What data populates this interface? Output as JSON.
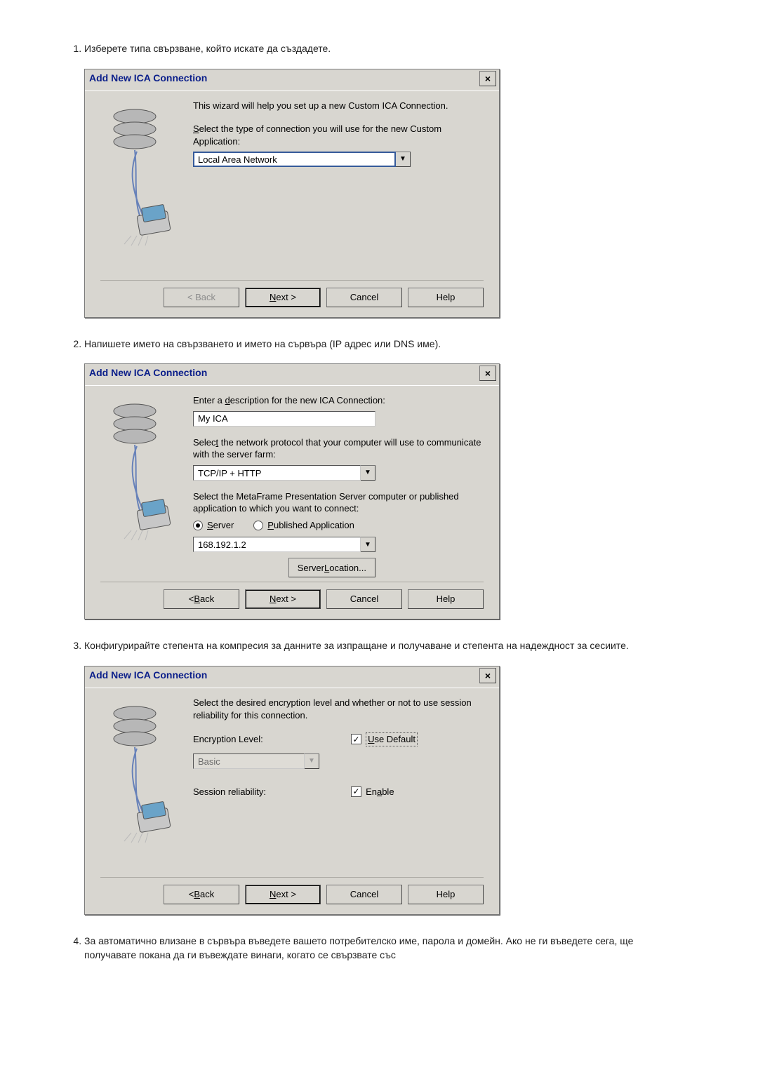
{
  "steps": {
    "s1": "Изберете типа свързване, който искате да създадете.",
    "s2": "Напишете името на свързването и името на сървъра (IP адрес или DNS име).",
    "s3": "Конфигурирайте степента на компресия за данните за изпращане и получаване и степента на надеждност за сесиите.",
    "s4": "За автоматично влизане в сървъра въведете вашето потребителско име, парола и домейн. Ако не ги въведете сега, ще получавате покана да ги въвеждате винаги, когато се свързвате със"
  },
  "dialog": {
    "title": "Add New ICA Connection",
    "close": "×",
    "buttons": {
      "back": "< Back",
      "next": "Next >",
      "cancel": "Cancel",
      "help": "Help"
    }
  },
  "d1": {
    "intro": "This wizard will help you set up a new Custom ICA Connection.",
    "select_label": "Select the type of connection you will use for the new Custom Application:",
    "connection_type": "Local Area Network"
  },
  "d2": {
    "desc_label": "Enter a description for the new ICA Connection:",
    "desc_value": "My ICA",
    "proto_label": "Select the network protocol that your computer will use to communicate with the server farm:",
    "proto_value": "TCP/IP + HTTP",
    "target_label": "Select the MetaFrame Presentation Server computer or published application to which you want to connect:",
    "radio_server": "Server",
    "radio_pub": "Published Application",
    "server_value": "168.192.1.2",
    "server_location_btn": "Server Location..."
  },
  "d3": {
    "intro": "Select the desired encryption level and whether or not to use session reliability for this connection.",
    "enc_label": "Encryption Level:",
    "use_default": "Use Default",
    "enc_value": "Basic",
    "reliability_label": "Session reliability:",
    "enable": "Enable"
  }
}
